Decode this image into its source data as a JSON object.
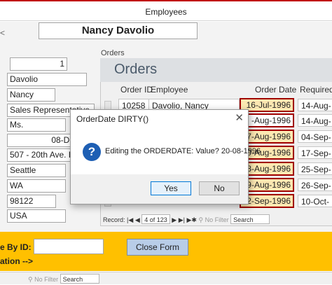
{
  "window": {
    "title": "Employees"
  },
  "header": {
    "employee_name": "Nancy Davolio"
  },
  "fields": {
    "employee_id": "1",
    "last_name": "Davolio",
    "first_name": "Nancy",
    "title": "Sales Representative",
    "courtesy": "Ms.",
    "birth_date": "08-De",
    "address": "507 - 20th Ave. E.",
    "city": "Seattle",
    "region": "WA",
    "postal": "98122",
    "country": "USA"
  },
  "orders": {
    "label": "Orders",
    "title": "Orders",
    "columns": [
      "Order ID",
      "Employee",
      "Order Date",
      "Required"
    ],
    "rows": [
      {
        "order_id": "10258",
        "employee": "Davolio, Nancy",
        "order_date": "16-Jul-1996",
        "required": "14-Aug-"
      },
      {
        "order_id": "",
        "employee": "",
        "order_date": "-Aug-1996",
        "required": "14-Aug-"
      },
      {
        "order_id": "",
        "employee": "",
        "order_date": "07-Aug-1996",
        "required": "04-Sep-"
      },
      {
        "order_id": "",
        "employee": "",
        "order_date": "20-Aug-1996",
        "required": "17-Sep-"
      },
      {
        "order_id": "",
        "employee": "",
        "order_date": "28-Aug-1996",
        "required": "25-Sep-"
      },
      {
        "order_id": "",
        "employee": "",
        "order_date": "29-Aug-1996",
        "required": "26-Sep-"
      },
      {
        "order_id": "",
        "employee": "",
        "order_date": "12-Sep-1996",
        "required": "10-Oct-"
      }
    ],
    "nav": {
      "label": "Record:",
      "position": "4 of 123",
      "filter": "No Filter",
      "search": "Search"
    }
  },
  "footer": {
    "by_id_label": "e By ID:",
    "close_button": "Close Form",
    "action_label": "ation -->",
    "nav": {
      "filter": "No Filter",
      "search": "Search"
    }
  },
  "dialog": {
    "title": "OrderDate DIRTY()",
    "message": "Editing the ORDERDATE: Value? 20-08-1996",
    "yes": "Yes",
    "no": "No",
    "close": "✕"
  }
}
